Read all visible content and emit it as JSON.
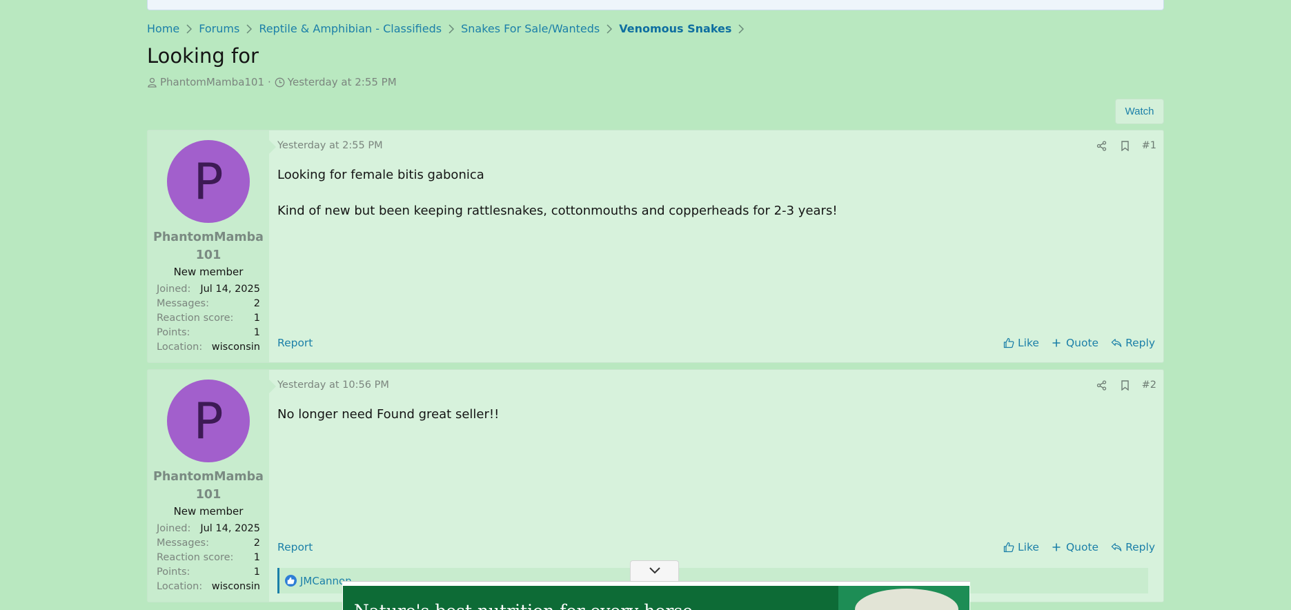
{
  "breadcrumb": [
    {
      "label": "Home"
    },
    {
      "label": "Forums"
    },
    {
      "label": "Reptile & Amphibian - Classifieds"
    },
    {
      "label": "Snakes For Sale/Wanteds"
    },
    {
      "label": "Venomous Snakes"
    }
  ],
  "thread": {
    "title": "Looking for",
    "author": "PhantomMamba101",
    "date": "Yesterday at 2:55 PM",
    "watch_label": "Watch"
  },
  "posts": [
    {
      "avatar_letter": "P",
      "username_line1": "PhantomMamba",
      "username_line2": "101",
      "user_title": "New member",
      "stats": [
        {
          "label": "Joined:",
          "value": "Jul 14, 2025"
        },
        {
          "label": "Messages:",
          "value": "2"
        },
        {
          "label": "Reaction score:",
          "value": "1"
        },
        {
          "label": "Points:",
          "value": "1"
        },
        {
          "label": "Location:",
          "value": "wisconsin"
        }
      ],
      "date": "Yesterday at 2:55 PM",
      "number": "#1",
      "paragraphs": [
        "Looking for female bitis gabonica",
        "Kind of new but been keeping rattlesnakes, cottonmouths and copperheads for 2-3 years!"
      ],
      "report_label": "Report",
      "like_label": "Like",
      "quote_label": "Quote",
      "reply_label": "Reply"
    },
    {
      "avatar_letter": "P",
      "username_line1": "PhantomMamba",
      "username_line2": "101",
      "user_title": "New member",
      "stats": [
        {
          "label": "Joined:",
          "value": "Jul 14, 2025"
        },
        {
          "label": "Messages:",
          "value": "2"
        },
        {
          "label": "Reaction score:",
          "value": "1"
        },
        {
          "label": "Points:",
          "value": "1"
        },
        {
          "label": "Location:",
          "value": "wisconsin"
        }
      ],
      "date": "Yesterday at 10:56 PM",
      "number": "#2",
      "paragraphs": [
        "No longer need Found great seller!!"
      ],
      "report_label": "Report",
      "like_label": "Like",
      "quote_label": "Quote",
      "reply_label": "Reply",
      "liked_by": "JMCannon"
    }
  ],
  "ad": {
    "text": "Nature's best nutrition for every horse"
  },
  "colors": {
    "background": "#b9e8c0",
    "link": "#1b7fa8",
    "avatar": "#a25fcc",
    "ad_green": "#0d6b36"
  },
  "icons": {
    "separator": "chevron-right-icon",
    "author": "user-icon",
    "date": "clock-icon",
    "share": "share-icon",
    "bookmark": "bookmark-icon",
    "like": "thumbs-up-icon",
    "quote": "plus-icon",
    "reply": "reply-icon",
    "ad_toggle": "chevron-down-icon"
  }
}
